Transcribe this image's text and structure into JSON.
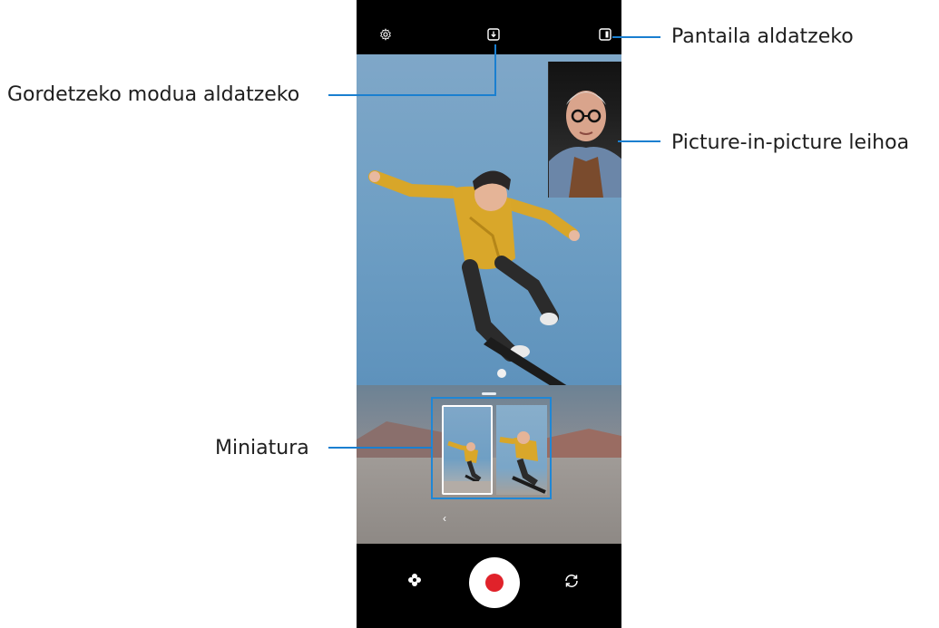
{
  "callouts": {
    "switch_screen": "Pantaila aldatzeko",
    "save_mode": "Gordetzeko modua aldatzeko",
    "pip_window": "Picture-in-picture leihoa",
    "thumbnail": "Miniatura"
  },
  "icons": {
    "settings": "gear-icon",
    "save_mode": "download-box-icon",
    "screen_toggle": "screen-split-icon",
    "effects": "flower-icon",
    "record": "record-icon",
    "switch_camera": "rotate-camera-icon",
    "collapse": "chevron-left-icon"
  },
  "colors": {
    "accent": "#1a7fd0",
    "record": "#e0222a",
    "background": "#000000"
  }
}
